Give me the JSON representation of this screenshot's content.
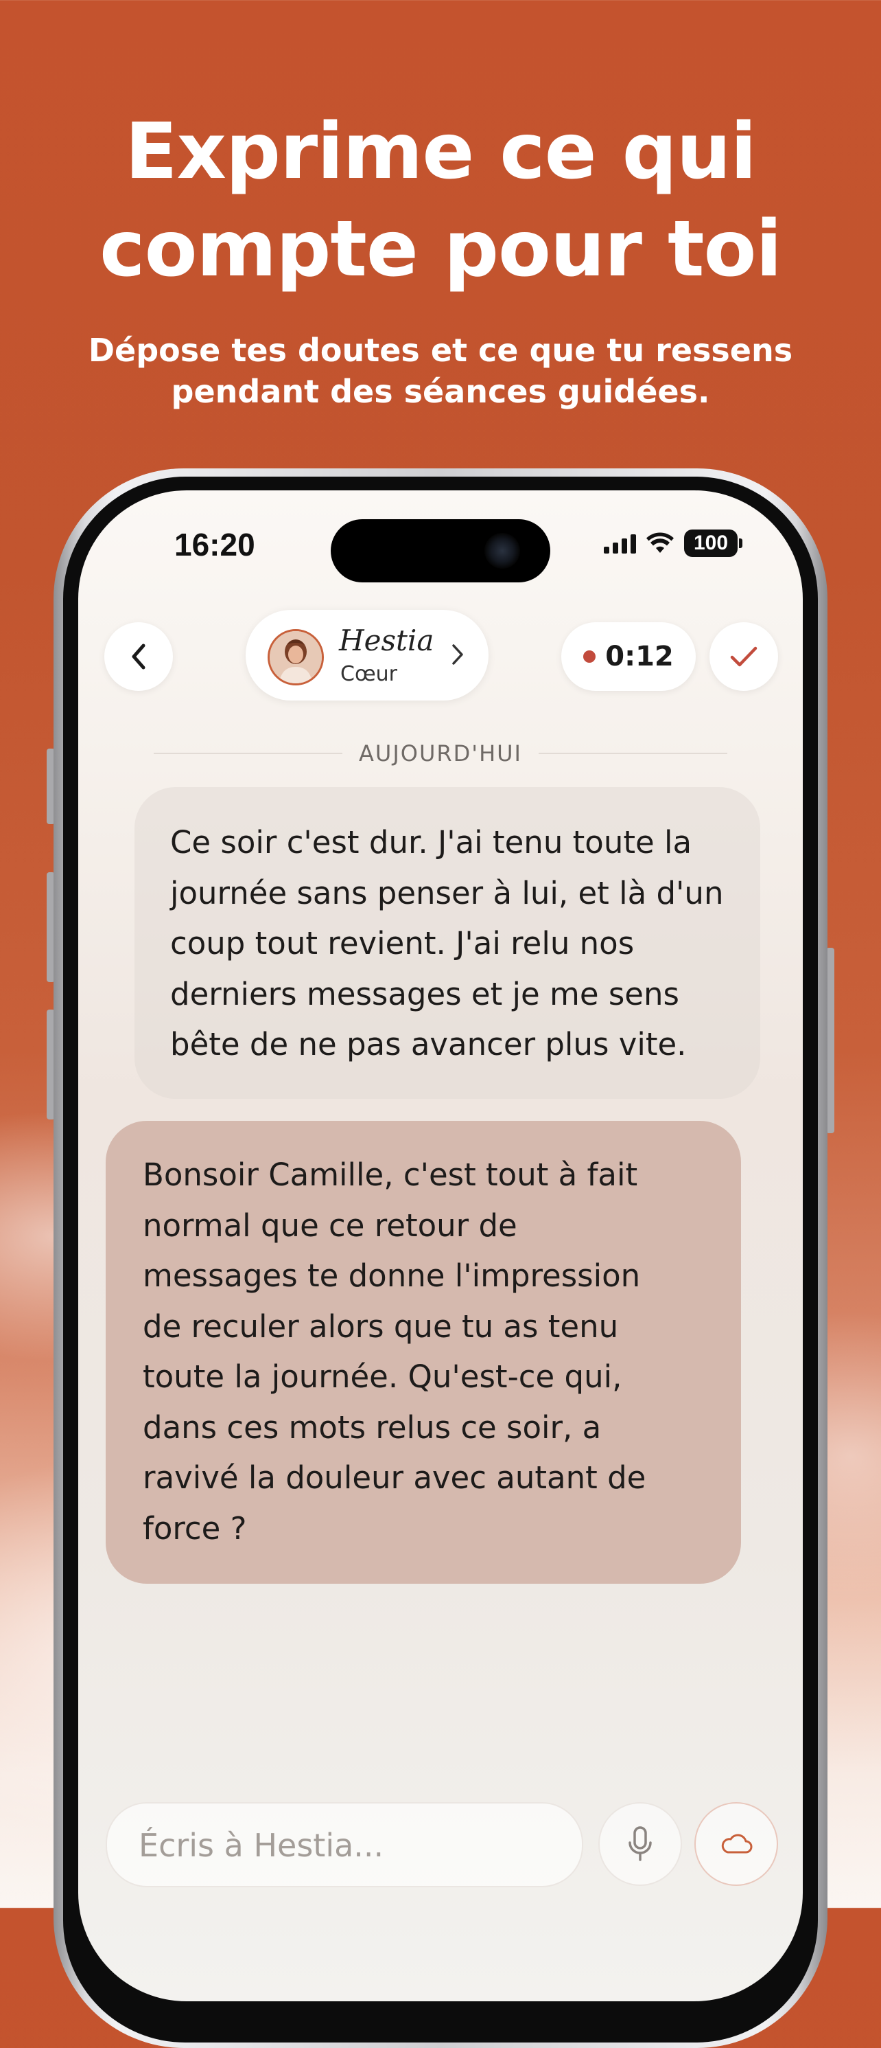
{
  "promo": {
    "headline_line1": "Exprime ce qui",
    "headline_line2": "compte pour toi",
    "subline_line1": "Dépose tes doutes et ce que tu ressens",
    "subline_line2": "pendant des séances guidées."
  },
  "status_bar": {
    "time": "16:20",
    "battery": "100"
  },
  "header": {
    "back_icon": "chevron-left-icon",
    "persona_name": "Hestia",
    "persona_role": "Cœur",
    "persona_chevron_icon": "chevron-right-icon",
    "timer": "0:12",
    "done_icon": "check-icon"
  },
  "conversation": {
    "date_label": "AUJOURD'HUI",
    "messages": [
      {
        "role": "user",
        "lines": [
          "Ce soir c'est dur. J'ai tenu toute la",
          "journée sans penser à lui, et là d'un",
          "coup tout revient. J'ai relu nos",
          "derniers messages et je me sens",
          "bête de ne pas avancer plus vite."
        ]
      },
      {
        "role": "assistant",
        "lines": [
          "Bonsoir Camille, c'est tout à fait",
          "normal que ce retour de",
          "messages te donne l'impression",
          "de reculer alors que tu as tenu",
          "toute la journée. Qu'est-ce qui,",
          "dans ces mots relus ce soir, a",
          "ravivé la douleur avec autant de",
          "force ?"
        ]
      }
    ]
  },
  "composer": {
    "placeholder": "Écris à Hestia...",
    "value": "",
    "mic_icon": "microphone-icon",
    "cloud_icon": "cloud-icon"
  },
  "colors": {
    "brand_orange": "#c4532e",
    "record_red": "#c24b3c",
    "assistant_bubble": "#d5b9ae"
  }
}
